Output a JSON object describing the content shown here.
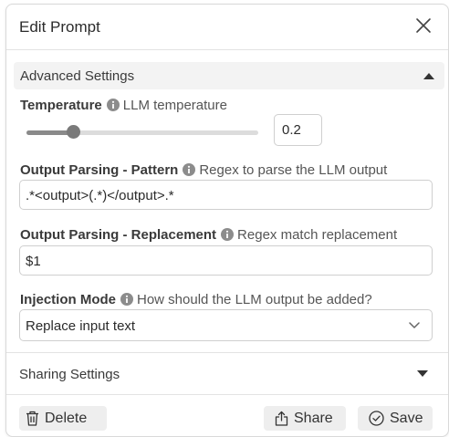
{
  "dialog": {
    "title": "Edit Prompt",
    "close_icon": "close-icon"
  },
  "advanced": {
    "label": "Advanced Settings",
    "expanded": true
  },
  "temperature": {
    "label": "Temperature",
    "description": "LLM temperature",
    "value": "0.2",
    "slider_fraction": 0.2
  },
  "pattern": {
    "label": "Output Parsing - Pattern",
    "description": "Regex to parse the LLM output",
    "value": ".*<output>(.*)</output>.*"
  },
  "replacement": {
    "label": "Output Parsing - Replacement",
    "description": "Regex match replacement",
    "value": "$1"
  },
  "injection": {
    "label": "Injection Mode",
    "description": "How should the LLM output be added?",
    "value": "Replace input text"
  },
  "sharing": {
    "label": "Sharing Settings",
    "expanded": false
  },
  "footer": {
    "delete_label": "Delete",
    "share_label": "Share",
    "save_label": "Save"
  },
  "colors": {
    "panel_bg": "#f3f3f3",
    "button_bg": "#eeeeee",
    "slider_fill": "#8a8a8a",
    "border": "#cfcfcf"
  }
}
